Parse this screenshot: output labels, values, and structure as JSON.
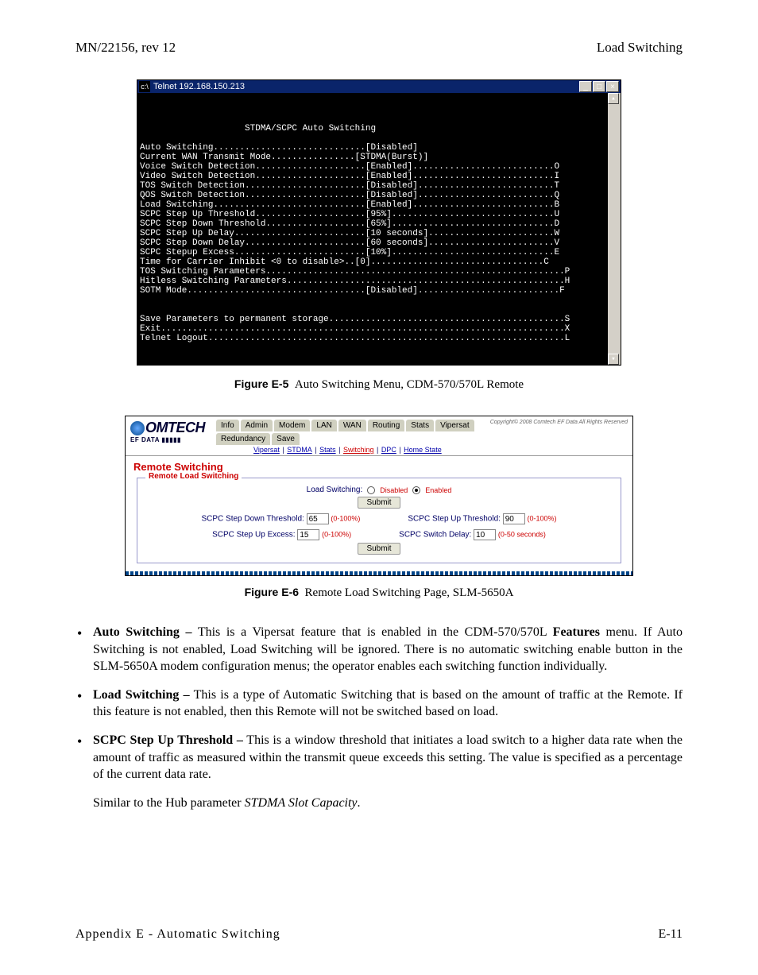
{
  "header": {
    "left": "MN/22156, rev 12",
    "right": "Load Switching"
  },
  "telnet": {
    "title": "Telnet 192.168.150.213",
    "heading": "STDMA/SCPC Auto Switching",
    "lines": [
      "Auto Switching.............................[Disabled]",
      "Current WAN Transmit Mode................[STDMA(Burst)]",
      "Voice Switch Detection.....................[Enabled]...........................O",
      "Video Switch Detection.....................[Enabled]...........................I",
      "TOS Switch Detection.......................[Disabled]..........................T",
      "QOS Switch Detection.......................[Disabled]..........................Q",
      "Load Switching.............................[Enabled]...........................B",
      "SCPC Step Up Threshold.....................[95%]...............................U",
      "SCPC Step Down Threshold...................[65%]...............................D",
      "SCPC Step Up Delay.........................[10 seconds]........................W",
      "SCPC Step Down Delay.......................[60 seconds]........................V",
      "SCPC Stepup Excess.........................[10%]...............................E",
      "Time for Carrier Inhibit <0 to disable>..[0].................................C",
      "TOS Switching Parameters.........................................................P",
      "Hitless Switching Parameters.....................................................H",
      "SOTM Mode..................................[Disabled]...........................F",
      "",
      "",
      "Save Parameters to permanent storage.............................................S",
      "Exit.............................................................................X",
      "Telnet Logout....................................................................L"
    ]
  },
  "fig1": {
    "num": "Figure E-5",
    "cap": "Auto Switching Menu, CDM-570/570L Remote"
  },
  "web": {
    "logo_main": "OMTECH",
    "logo_sub": "EF DATA ▮▮▮▮▮",
    "tabs": [
      "Info",
      "Admin",
      "Modem",
      "LAN",
      "WAN",
      "Routing",
      "Stats",
      "Vipersat",
      "Redundancy",
      "Save"
    ],
    "sublinks": [
      "Vipersat",
      "STDMA",
      "Stats",
      "Switching",
      "DPC",
      "Home State"
    ],
    "copyright": "Copyright© 2008\nComtech EF Data\nAll Rights Reserved",
    "section": "Remote Switching",
    "legend": "Remote Load Switching",
    "load_label": "Load Switching:",
    "disabled": "Disabled",
    "enabled": "Enabled",
    "submit": "Submit",
    "sdt_label": "SCPC Step Down Threshold:",
    "sdt_val": "65",
    "sue_label": "SCPC Step Up Excess:",
    "sue_val": "15",
    "sut_label": "SCPC Step Up Threshold:",
    "sut_val": "90",
    "ssd_label": "SCPC Switch Delay:",
    "ssd_val": "10",
    "hint_pct": "(0-100%)",
    "hint_sec": "(0-50 seconds)"
  },
  "fig2": {
    "num": "Figure E-6",
    "cap": "Remote Load Switching Page, SLM-5650A"
  },
  "bullets": {
    "b1_lead": "Auto Switching –",
    "b1_text": " This is a Vipersat feature that is enabled in the CDM-570/570L ",
    "b1_feat": "Features",
    "b1_tail": " menu. If Auto Switching is not enabled, Load Switching will be ignored. There is no automatic switching enable button in the SLM-5650A modem configuration menus; the operator enables each switching function individually.",
    "b2_lead": "Load Switching –",
    "b2_text": " This is a type of Automatic Switching that is based on the amount of traffic at the Remote. If this feature is not enabled, then this Remote will not be switched based on load.",
    "b3_lead": "SCPC Step Up Threshold –",
    "b3_text": " This is a window threshold that initiates a load switch to a higher data rate when the amount of traffic as measured within the transmit queue exceeds this setting. The value is specified as a percentage of the current data rate.",
    "p1a": "Similar to the Hub parameter ",
    "p1i": "STDMA Slot Capacity",
    "p1b": "."
  },
  "footer": {
    "left": "Appendix E - Automatic Switching",
    "right": "E-11"
  }
}
